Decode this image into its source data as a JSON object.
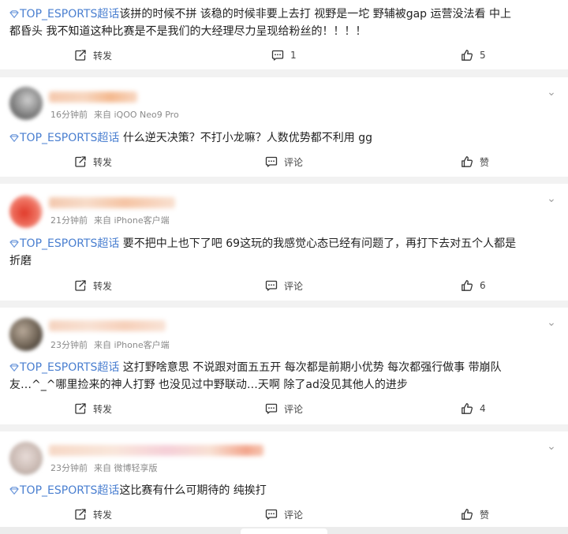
{
  "comments": [
    {
      "topic": "TOP_ESPORTS超话",
      "text_lines": [
        "该拼的时候不拼 该稳的时候非要上去打  视野是一坨 野辅被gap 运营没法看  中上",
        "都昏头 我不知道这种比赛是不是我们的大经理尽力呈现给粉丝的！！！！"
      ],
      "actions": {
        "repost": "转发",
        "comment": "1",
        "like": "5"
      }
    },
    {
      "time": "16分钟前",
      "source": "来自 iQOO Neo9 Pro",
      "topic": "TOP_ESPORTS超话",
      "text_lines": [
        "什么逆天决策？不打小龙嘛？人数优势都不利用 gg"
      ],
      "actions": {
        "repost": "转发",
        "comment": "评论",
        "like": "赞"
      }
    },
    {
      "time": "21分钟前",
      "source": "来自 iPhone客户端",
      "topic": "TOP_ESPORTS超话",
      "text_lines": [
        "   要不把中上也下了吧 69这玩的我感觉心态已经有问题了，再打下去对五个人都是",
        "折磨"
      ],
      "actions": {
        "repost": "转发",
        "comment": "评论",
        "like": "6"
      }
    },
    {
      "time": "23分钟前",
      "source": "来自 iPhone客户端",
      "topic": "TOP_ESPORTS超话",
      "text_lines": [
        "  这打野啥意思 不说跟对面五五开 每次都是前期小优势 每次都强行做事 带崩队",
        "友…^_^哪里捡来的神人打野 也没见过中野联动…天啊 除了ad没见其他人的进步"
      ],
      "actions": {
        "repost": "转发",
        "comment": "评论",
        "like": "4"
      }
    },
    {
      "time": "23分钟前",
      "source": "来自 微博轻享版",
      "topic": "TOP_ESPORTS超话",
      "text_lines": [
        "这比赛有什么可期待的 纯挨打"
      ],
      "actions": {
        "repost": "转发",
        "comment": "评论",
        "like": "赞"
      }
    }
  ],
  "colors": {
    "topic": "#4a7fd0",
    "background": "#f2f2f2",
    "card": "#ffffff"
  },
  "icons": [
    "diamond-icon",
    "repost-icon",
    "comment-icon",
    "like-icon",
    "more-chevron-icon"
  ]
}
